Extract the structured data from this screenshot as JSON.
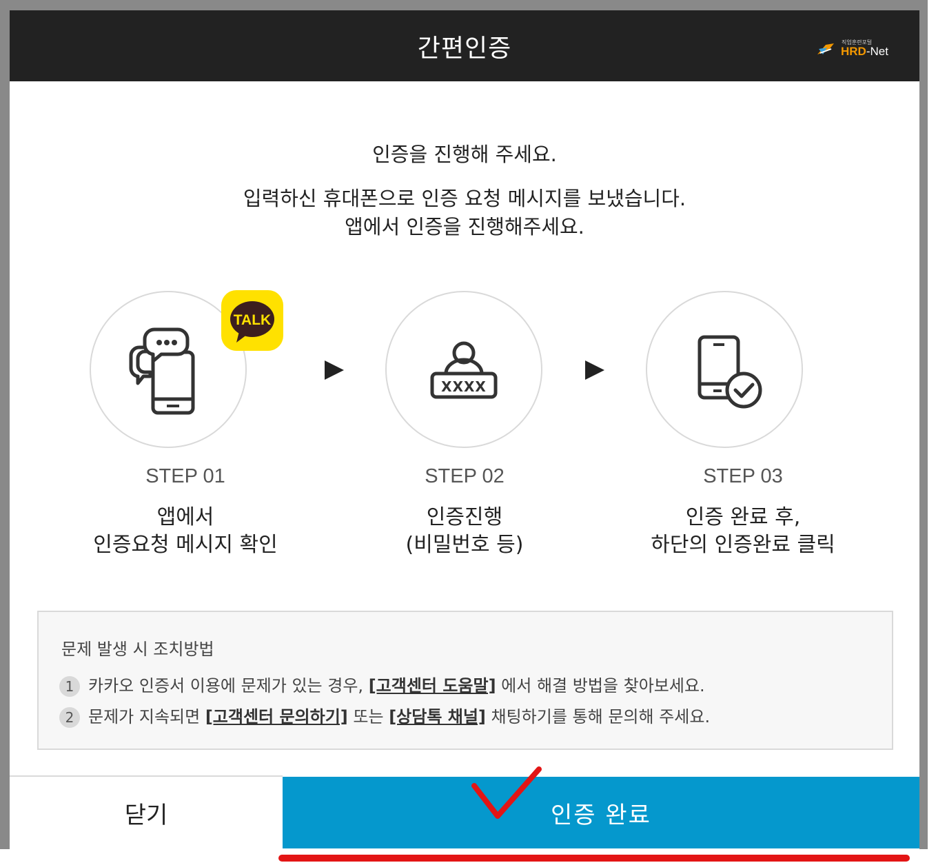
{
  "header": {
    "title": "간편인증",
    "logo_small": "직업훈련포털",
    "logo_hrd": "HRD",
    "logo_net": "-Net"
  },
  "message": {
    "line1": "인증을 진행해 주세요.",
    "line2": "입력하신 휴대폰으로 인증 요청 메시지를 보냈습니다.",
    "line3": "앱에서 인증을 진행해주세요."
  },
  "badge": {
    "talk": "TALK",
    "color": "#ffe100"
  },
  "steps": [
    {
      "label": "STEP 01",
      "line1": "앱에서",
      "line2": "인증요청 메시지 확인",
      "icon": "phone-chat-icon"
    },
    {
      "label": "STEP 02",
      "line1": "인증진행",
      "line2": "(비밀번호 등)",
      "icon": "user-password-icon"
    },
    {
      "label": "STEP 03",
      "line1": "인증 완료 후,",
      "line2": "하단의 인증완료 클릭",
      "icon": "phone-check-icon"
    }
  ],
  "password_mask": "XXXX",
  "troubleshoot": {
    "title": "문제 발생 시 조치방법",
    "items": [
      {
        "num": "1",
        "pre": "카카오 인증서 이용에 문제가 있는 경우, ",
        "link1": "[고객센터 도움말]",
        "post": " 에서 해결 방법을 찾아보세요."
      },
      {
        "num": "2",
        "pre": "문제가 지속되면 ",
        "link1": "[고객센터 문의하기]",
        "mid": " 또는 ",
        "link2": "[상담톡 채널]",
        "post": " 채팅하기를 통해 문의해 주세요."
      }
    ]
  },
  "buttons": {
    "close": "닫기",
    "done": "인증 완료"
  },
  "colors": {
    "header_bg": "#222222",
    "primary": "#0598cd",
    "annotation": "#e31515"
  }
}
